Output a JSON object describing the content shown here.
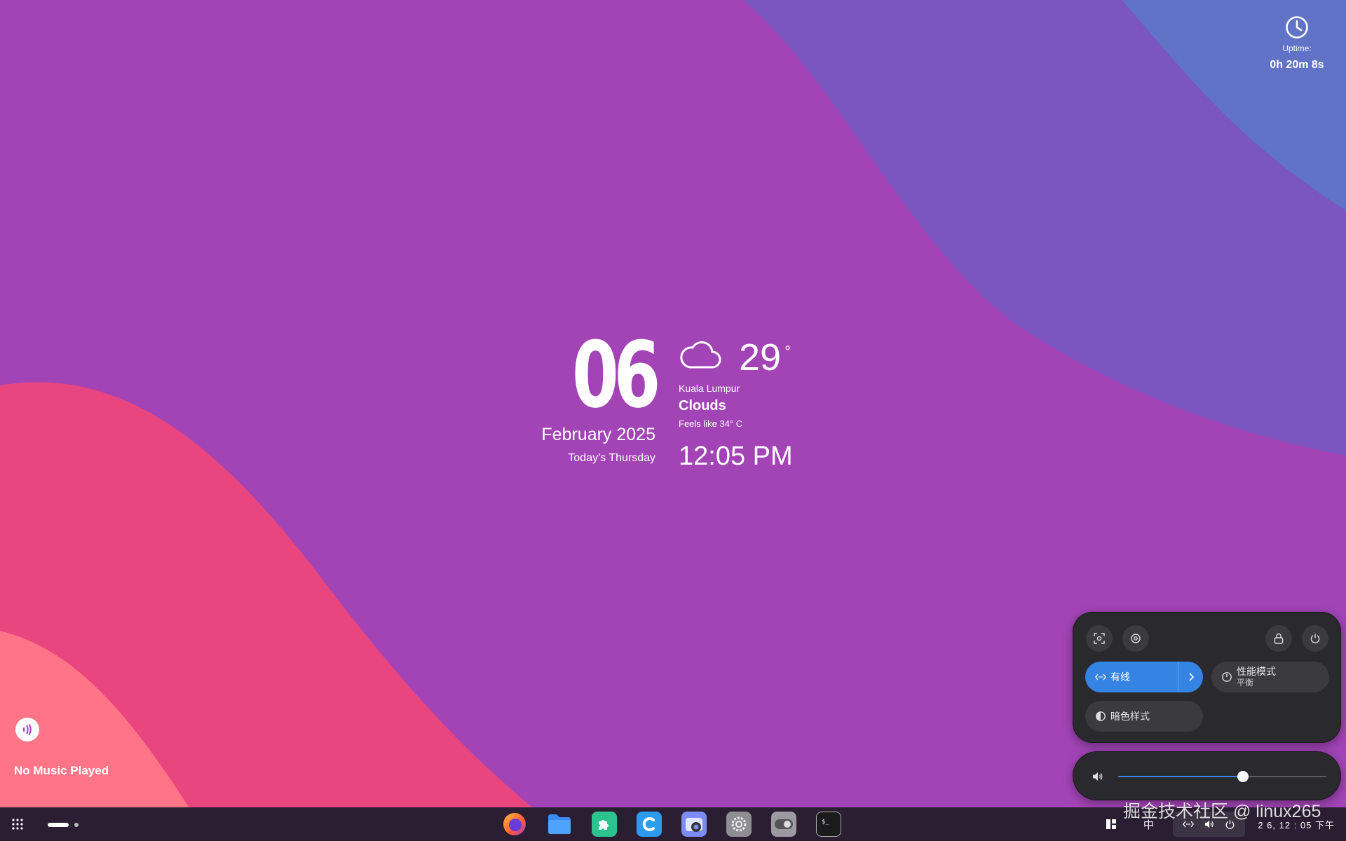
{
  "wallpaper": {
    "colors": [
      "#a244b6",
      "#7a55c1",
      "#5f70c6",
      "#e8457f",
      "#ff7585"
    ]
  },
  "uptime": {
    "icon": "clock-icon",
    "label": "Uptime:",
    "value": "0h 20m 8s"
  },
  "date": {
    "day": "06",
    "month_year": "February 2025",
    "weekday": "Today's Thursday"
  },
  "weather": {
    "icon": "cloud-icon",
    "temperature": "29",
    "degree_symbol": "°",
    "city": "Kuala Lumpur",
    "condition": "Clouds",
    "feels_like": "Feels like 34° C"
  },
  "clock": {
    "time": "12:05 PM"
  },
  "music": {
    "icon": "audio-wave-icon",
    "label": "No Music Played"
  },
  "quick_settings": {
    "buttons": [
      {
        "name": "screenshot-button",
        "icon": "screenshot-icon"
      },
      {
        "name": "settings-button",
        "icon": "settings-icon"
      },
      {
        "name": "lock-button",
        "icon": "lock-icon"
      },
      {
        "name": "power-button",
        "icon": "power-icon"
      }
    ],
    "wired": {
      "label": "有线",
      "icon": "network-wired-icon",
      "active": true
    },
    "power_mode": {
      "label": "性能模式",
      "sub": "平衡",
      "icon": "speedometer-icon"
    },
    "dark_style": {
      "label": "暗色样式",
      "icon": "contrast-icon"
    },
    "accent_color": "#3584e4"
  },
  "volume": {
    "icon": "speaker-icon",
    "level": 0.6
  },
  "taskbar": {
    "apps": [
      {
        "name": "firefox",
        "icon": "firefox-icon"
      },
      {
        "name": "files",
        "icon": "files-icon"
      },
      {
        "name": "extensions",
        "icon": "puzzle-icon"
      },
      {
        "name": "browser",
        "icon": "browser-c-icon"
      },
      {
        "name": "screenshot-tool",
        "icon": "camera-icon"
      },
      {
        "name": "settings",
        "icon": "gear-icon"
      },
      {
        "name": "tweaks",
        "icon": "toggle-icon"
      },
      {
        "name": "terminal",
        "icon": "terminal-icon"
      }
    ],
    "tray": {
      "input_method": "中",
      "clock": "2 6, 12 : 05 下午"
    }
  },
  "watermark": "掘金技术社区 @ linux265"
}
